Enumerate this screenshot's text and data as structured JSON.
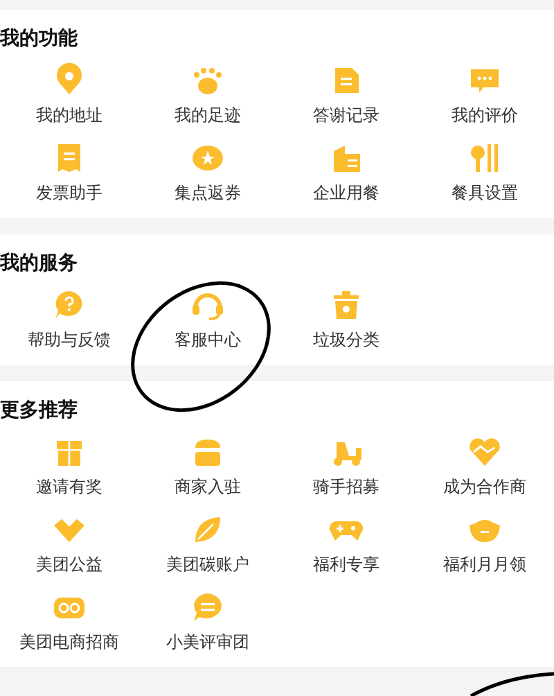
{
  "sections": [
    {
      "title": "我的功能",
      "items": [
        {
          "label": "我的地址"
        },
        {
          "label": "我的足迹"
        },
        {
          "label": "答谢记录"
        },
        {
          "label": "我的评价"
        },
        {
          "label": "发票助手"
        },
        {
          "label": "集点返券"
        },
        {
          "label": "企业用餐"
        },
        {
          "label": "餐具设置"
        }
      ]
    },
    {
      "title": "我的服务",
      "items": [
        {
          "label": "帮助与反馈"
        },
        {
          "label": "客服中心"
        },
        {
          "label": "垃圾分类"
        }
      ]
    },
    {
      "title": "更多推荐",
      "items": [
        {
          "label": "邀请有奖"
        },
        {
          "label": "商家入驻"
        },
        {
          "label": "骑手招募"
        },
        {
          "label": "成为合作商"
        },
        {
          "label": "美团公益"
        },
        {
          "label": "美团碳账户"
        },
        {
          "label": "福利专享"
        },
        {
          "label": "福利月月领"
        },
        {
          "label": "美团电商招商"
        },
        {
          "label": "小美评审团"
        }
      ]
    }
  ]
}
